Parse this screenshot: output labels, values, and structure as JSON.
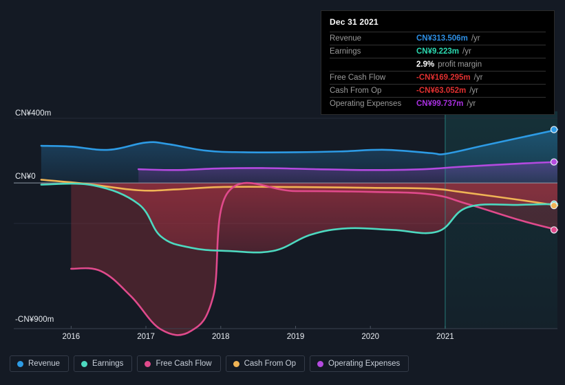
{
  "chart_data": {
    "type": "area",
    "title": "",
    "xlabel": "",
    "ylabel": "",
    "currency": "CN¥",
    "units": "m",
    "ylim": [
      -900,
      400
    ],
    "xlim": [
      2015.5,
      2022.5
    ],
    "grid": true,
    "legend_position": "bottom-left",
    "forecast_divider_x": 2021,
    "y_axis_ticks": [
      {
        "label": "CN¥400m",
        "value": 400
      },
      {
        "label": "CN¥0",
        "value": 0
      },
      {
        "label": "-CN¥900m",
        "value": -900
      }
    ],
    "x_axis_ticks": [
      "2016",
      "2017",
      "2018",
      "2019",
      "2020",
      "2021"
    ],
    "series": [
      {
        "name": "Revenue",
        "color": "#2D9BE5",
        "x": [
          2015.6,
          2016.0,
          2016.5,
          2017.0,
          2017.3,
          2017.8,
          2018.3,
          2019.0,
          2019.6,
          2020.2,
          2020.8,
          2021.0,
          2021.5,
          2022.0,
          2022.5
        ],
        "values": [
          230,
          225,
          205,
          250,
          240,
          200,
          190,
          190,
          195,
          205,
          185,
          180,
          230,
          280,
          330
        ]
      },
      {
        "name": "Earnings",
        "color": "#4DD9C0",
        "x": [
          2015.6,
          2016.3,
          2016.9,
          2017.2,
          2017.6,
          2018.1,
          2018.7,
          2019.2,
          2019.7,
          2020.3,
          2020.9,
          2021.3,
          2022.0,
          2022.5
        ],
        "values": [
          -10,
          -15,
          -130,
          -330,
          -400,
          -420,
          -420,
          -320,
          -280,
          -290,
          -300,
          -150,
          -135,
          -130
        ]
      },
      {
        "name": "Free Cash Flow",
        "color": "#E04A8C",
        "x": [
          2016.0,
          2016.4,
          2016.8,
          2017.2,
          2017.6,
          2017.9,
          2018.1,
          2019.0,
          2020.0,
          2020.8,
          2021.3,
          2022.0,
          2022.5
        ],
        "values": [
          -530,
          -545,
          -700,
          -905,
          -915,
          -700,
          -55,
          -50,
          -55,
          -70,
          -130,
          -230,
          -290
        ]
      },
      {
        "name": "Cash From Op",
        "color": "#F0B455",
        "x": [
          2015.6,
          2016.2,
          2016.9,
          2017.4,
          2018.0,
          2019.0,
          2020.0,
          2020.8,
          2021.2,
          2022.0,
          2022.5
        ],
        "values": [
          20,
          -5,
          -45,
          -40,
          -25,
          -25,
          -30,
          -35,
          -55,
          -105,
          -140
        ]
      },
      {
        "name": "Operating Expenses",
        "color": "#B44AE0",
        "x": [
          2016.9,
          2017.4,
          2018.0,
          2018.6,
          2019.3,
          2020.0,
          2020.7,
          2021.2,
          2022.0,
          2022.5
        ],
        "values": [
          85,
          80,
          90,
          92,
          85,
          80,
          85,
          100,
          120,
          130
        ]
      }
    ],
    "end_markers": [
      {
        "name": "Revenue",
        "value": 330,
        "color": "#2D9BE5"
      },
      {
        "name": "Operating Expenses",
        "value": 130,
        "color": "#B44AE0"
      },
      {
        "name": "Earnings",
        "value": -130,
        "color": "#4DD9C0"
      },
      {
        "name": "Cash From Op",
        "value": -140,
        "color": "#F0B455"
      },
      {
        "name": "Free Cash Flow",
        "value": -290,
        "color": "#E04A8C"
      }
    ]
  },
  "tooltip": {
    "title": "Dec 31 2021",
    "rows": [
      {
        "label": "Revenue",
        "value": "CN¥313.506m",
        "unit": "/yr",
        "value_class": "v-rev"
      },
      {
        "label": "Earnings",
        "value": "CN¥9.223m",
        "unit": "/yr",
        "value_class": "v-earn"
      },
      {
        "label": "",
        "value": "2.9%",
        "unit": "profit margin",
        "value_class": "v-white"
      },
      {
        "label": "Free Cash Flow",
        "value": "-CN¥169.295m",
        "unit": "/yr",
        "value_class": "v-neg"
      },
      {
        "label": "Cash From Op",
        "value": "-CN¥63.052m",
        "unit": "/yr",
        "value_class": "v-neg"
      },
      {
        "label": "Operating Expenses",
        "value": "CN¥99.737m",
        "unit": "/yr",
        "value_class": "v-opex"
      }
    ]
  },
  "legend": {
    "items": [
      {
        "label": "Revenue",
        "color": "#2D9BE5"
      },
      {
        "label": "Earnings",
        "color": "#4DD9C0"
      },
      {
        "label": "Free Cash Flow",
        "color": "#E04A8C"
      },
      {
        "label": "Cash From Op",
        "color": "#F0B455"
      },
      {
        "label": "Operating Expenses",
        "color": "#B44AE0"
      }
    ]
  },
  "theme": {
    "background": "#141A24",
    "zero_line": "#9AA3B0",
    "grid_line": "#232B38",
    "forecast_tint": "#0E3A3C"
  }
}
